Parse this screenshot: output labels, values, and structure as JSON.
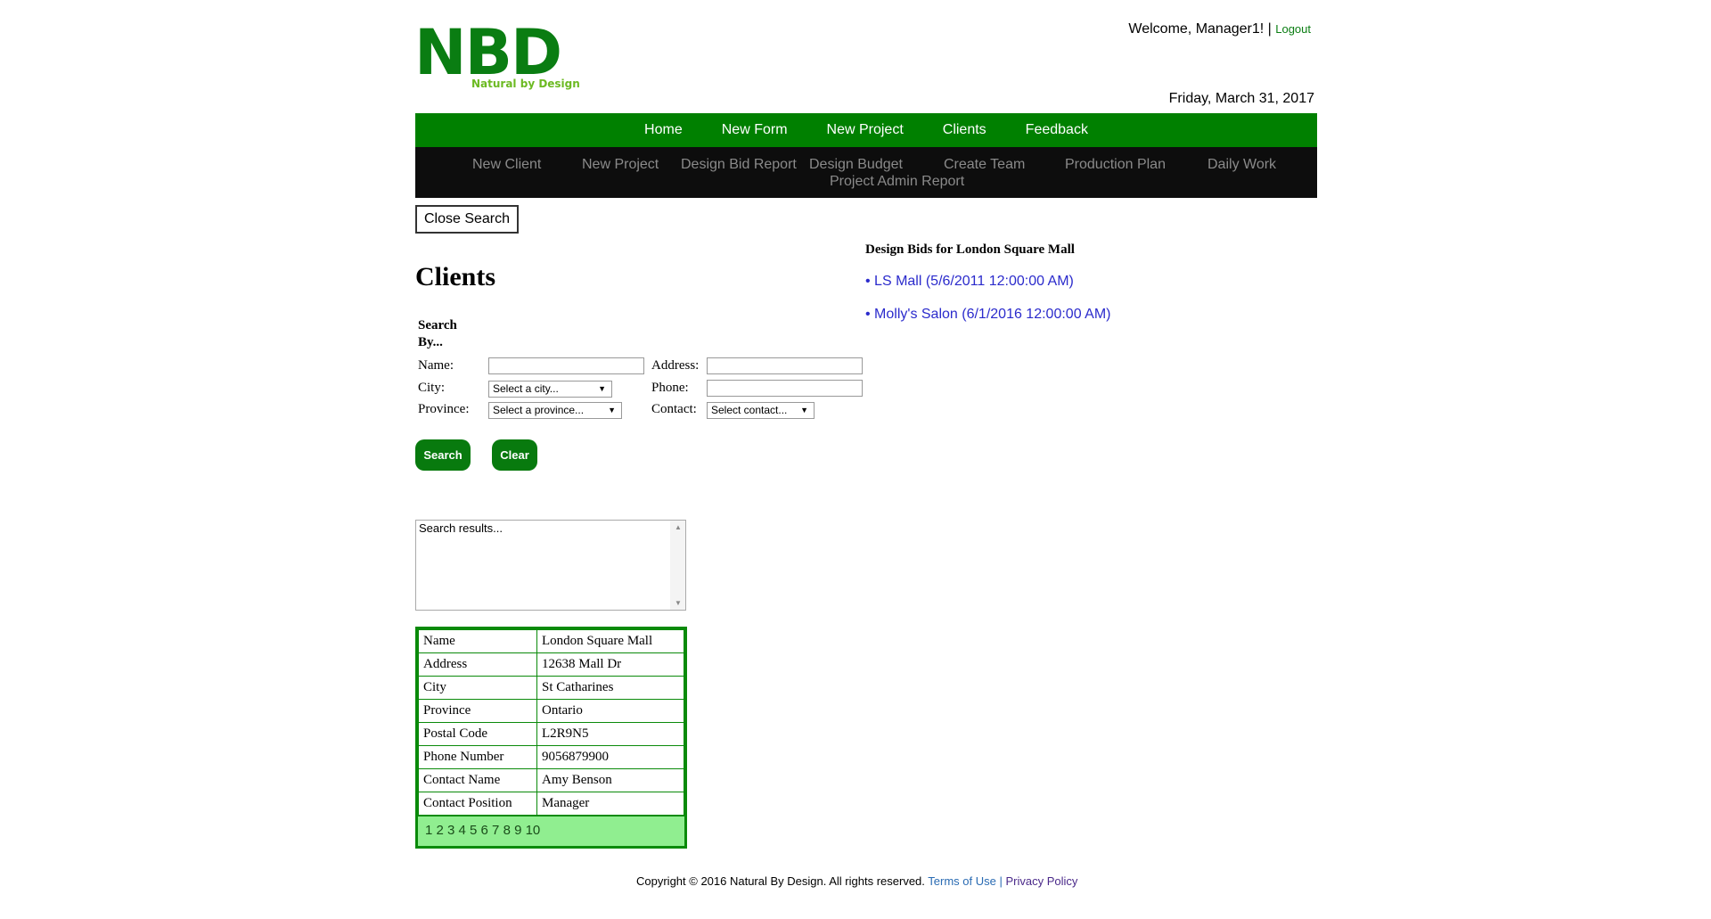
{
  "header": {
    "logo_text": "NBD",
    "logo_tagline": "Natural by Design",
    "welcome": "Welcome, Manager1! |",
    "logout": "Logout",
    "date": "Friday, March 31, 2017"
  },
  "main_nav": [
    "Home",
    "New Form",
    "New Project",
    "Clients",
    "Feedback"
  ],
  "sub_nav": [
    "New Client",
    "New Project",
    "Design Bid Report",
    "Design Budget",
    "Create Team",
    "Production Plan",
    "Daily Work",
    "Project Admin Report"
  ],
  "close_search_label": "Close Search",
  "page_title": "Clients",
  "search": {
    "heading": "Search By...",
    "name_label": "Name:",
    "address_label": "Address:",
    "city_label": "City:",
    "phone_label": "Phone:",
    "province_label": "Province:",
    "contact_label": "Contact:",
    "city_select": "Select a city...",
    "province_select": "Select a province...",
    "contact_select": "Select contact...",
    "search_button": "Search",
    "clear_button": "Clear",
    "results_placeholder": "Search results..."
  },
  "client_details": [
    {
      "key": "Name",
      "value": "London Square Mall"
    },
    {
      "key": "Address",
      "value": "12638 Mall Dr"
    },
    {
      "key": "City",
      "value": "St Catharines"
    },
    {
      "key": "Province",
      "value": "Ontario"
    },
    {
      "key": "Postal Code",
      "value": "L2R9N5"
    },
    {
      "key": "Phone Number",
      "value": "9056879900"
    },
    {
      "key": "Contact Name",
      "value": "Amy Benson"
    },
    {
      "key": "Contact Position",
      "value": "Manager"
    }
  ],
  "pager": "1 2 3 4 5 6 7 8 9 10",
  "design_bids": {
    "title": "Design Bids for London Square Mall",
    "items": [
      "• LS Mall (5/6/2011 12:00:00 AM)",
      "• Molly's Salon (6/1/2016 12:00:00 AM)"
    ]
  },
  "footer": {
    "copyright": "Copyright © 2016 Natural By Design. All rights reserved.",
    "terms": "Terms of Use",
    "separator": "|",
    "privacy": "Privacy Policy"
  },
  "colors": {
    "brand_green": "#008000",
    "subnav_bg": "#0d0d0d",
    "pager_bg": "#90ee90",
    "bid_link": "#2b2bcc"
  }
}
